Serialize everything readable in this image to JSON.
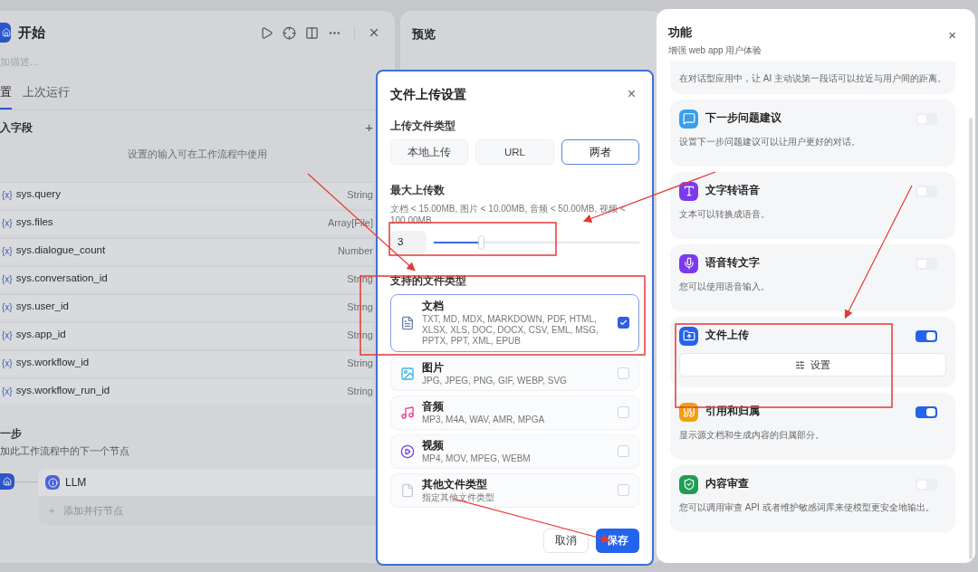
{
  "start_panel": {
    "title": "开始",
    "description_placeholder": "加描述...",
    "tabs": [
      {
        "label": "置",
        "selected": true
      },
      {
        "label": "上次运行",
        "selected": false
      }
    ],
    "section_title": "入字段",
    "add": "+",
    "hint": "设置的输入可在工作流程中使用",
    "variables": [
      {
        "icon": "{x}",
        "name": "sys.query",
        "type": "String"
      },
      {
        "icon": "{x}",
        "name": "sys.files",
        "type": "Array[File]"
      },
      {
        "icon": "{x}",
        "name": "sys.dialogue_count",
        "type": "Number"
      },
      {
        "icon": "{x}",
        "name": "sys.conversation_id",
        "type": "String"
      },
      {
        "icon": "{x}",
        "name": "sys.user_id",
        "type": "String"
      },
      {
        "icon": "{x}",
        "name": "sys.app_id",
        "type": "String"
      },
      {
        "icon": "{x}",
        "name": "sys.workflow_id",
        "type": "String"
      },
      {
        "icon": "{x}",
        "name": "sys.workflow_run_id",
        "type": "String"
      }
    ],
    "next_step": {
      "title": "一步",
      "subtitle": "加此工作流程中的下一个节点",
      "node": "LLM",
      "add_parallel": "添加并行节点",
      "add_icon": "+"
    }
  },
  "preview": {
    "title": "预览"
  },
  "dialog": {
    "title": "文件上传设置",
    "close": "×",
    "upload_type_label": "上传文件类型",
    "upload_types": [
      {
        "label": "本地上传",
        "selected": false
      },
      {
        "label": "URL",
        "selected": false
      },
      {
        "label": "两者",
        "selected": true
      }
    ],
    "max_label": "最大上传数",
    "max_hint": "文档 < 15.00MB, 图片 < 10.00MB, 音频 < 50.00MB, 视频 < 100.00MB",
    "max_slider": {
      "value": "3",
      "level": 0.23
    },
    "file_types_label": "支持的文件类型",
    "file_types": [
      {
        "kind": "document",
        "name": "文档",
        "extensions": "TXT, MD, MDX, MARKDOWN, PDF, HTML, XLSX, XLS, DOC, DOCX, CSV, EML, MSG, PPTX, PPT, XML, EPUB",
        "checked": true,
        "selected": true
      },
      {
        "kind": "image",
        "name": "图片",
        "extensions": "JPG, JPEG, PNG, GIF, WEBP, SVG",
        "checked": false,
        "selected": false
      },
      {
        "kind": "audio",
        "name": "音频",
        "extensions": "MP3, M4A, WAV, AMR, MPGA",
        "checked": false,
        "selected": false
      },
      {
        "kind": "video",
        "name": "视频",
        "extensions": "MP4, MOV, MPEG, WEBM",
        "checked": false,
        "selected": false
      },
      {
        "kind": "other",
        "name": "其他文件类型",
        "extensions": "指定其他文件类型",
        "checked": false,
        "selected": false
      }
    ],
    "cancel": "取消",
    "save": "保存"
  },
  "features": {
    "title": "功能",
    "subtitle": "增强 web app 用户体验",
    "close": "×",
    "items": [
      {
        "description": "在对话型应用中，让 AI 主动说第一段话可以拉近与用户间的距离。"
      },
      {
        "kind": "chat",
        "title": "下一步问题建议",
        "description": "设置下一步问题建议可以让用户更好的对话。",
        "on": false
      },
      {
        "kind": "tts",
        "title": "文字转语音",
        "description": "文本可以转换成语音。",
        "on": false
      },
      {
        "kind": "mic",
        "title": "语音转文字",
        "description": "您可以使用语音输入。",
        "on": false
      },
      {
        "kind": "folder",
        "title": "文件上传",
        "settings_button": "设置",
        "on": true
      },
      {
        "kind": "quote",
        "title": "引用和归属",
        "description": "显示源文档和生成内容的归属部分。",
        "on": true
      },
      {
        "kind": "moderation",
        "title": "内容审查",
        "description": "您可以调用审查 API 或者维护敏感词库来使模型更安全地输出。",
        "on": false
      }
    ]
  }
}
